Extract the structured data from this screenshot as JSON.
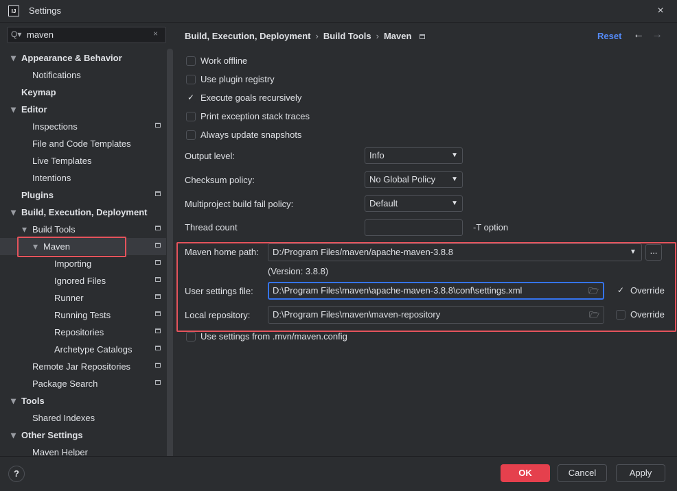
{
  "window": {
    "title": "Settings",
    "logo_text": "IJ",
    "close_icon": "×"
  },
  "search": {
    "value": "maven",
    "icon": "Q▾",
    "clear_icon": "×"
  },
  "sidebar": {
    "items": [
      {
        "label": "Appearance & Behavior",
        "level": 0,
        "expanded": true,
        "bold": true
      },
      {
        "label": "Notifications",
        "level": 1
      },
      {
        "label": "Keymap",
        "level": 0,
        "bold": true
      },
      {
        "label": "Editor",
        "level": 0,
        "expanded": true,
        "bold": true
      },
      {
        "label": "Inspections",
        "level": 1,
        "badge": true
      },
      {
        "label": "File and Code Templates",
        "level": 1
      },
      {
        "label": "Live Templates",
        "level": 1
      },
      {
        "label": "Intentions",
        "level": 1
      },
      {
        "label": "Plugins",
        "level": 0,
        "bold": true,
        "badge": true
      },
      {
        "label": "Build, Execution, Deployment",
        "level": 0,
        "expanded": true,
        "bold": true
      },
      {
        "label": "Build Tools",
        "level": 1,
        "expanded": true,
        "badge": true
      },
      {
        "label": "Maven",
        "level": 2,
        "expanded": true,
        "badge": true,
        "selected": true
      },
      {
        "label": "Importing",
        "level": 3,
        "badge": true
      },
      {
        "label": "Ignored Files",
        "level": 3,
        "badge": true
      },
      {
        "label": "Runner",
        "level": 3,
        "badge": true
      },
      {
        "label": "Running Tests",
        "level": 3,
        "badge": true
      },
      {
        "label": "Repositories",
        "level": 3,
        "badge": true
      },
      {
        "label": "Archetype Catalogs",
        "level": 3,
        "badge": true
      },
      {
        "label": "Remote Jar Repositories",
        "level": 1,
        "badge": true
      },
      {
        "label": "Package Search",
        "level": 1,
        "badge": true
      },
      {
        "label": "Tools",
        "level": 0,
        "expanded": true,
        "bold": true
      },
      {
        "label": "Shared Indexes",
        "level": 1
      },
      {
        "label": "Other Settings",
        "level": 0,
        "expanded": true,
        "bold": true
      },
      {
        "label": "Maven Helper",
        "level": 1
      }
    ]
  },
  "breadcrumb": {
    "items": [
      "Build, Execution, Deployment",
      "Build Tools",
      "Maven"
    ],
    "separator": "›"
  },
  "header": {
    "reset": "Reset",
    "back_icon": "←",
    "forward_icon": "→"
  },
  "checkboxes": [
    {
      "label": "Work offline",
      "checked": false
    },
    {
      "label": "Use plugin registry",
      "checked": false
    },
    {
      "label": "Execute goals recursively",
      "checked": true
    },
    {
      "label": "Print exception stack traces",
      "checked": false
    },
    {
      "label": "Always update snapshots",
      "checked": false
    }
  ],
  "form": {
    "output_level": {
      "label": "Output level:",
      "value": "Info"
    },
    "checksum_policy": {
      "label": "Checksum policy:",
      "value": "No Global Policy"
    },
    "fail_policy": {
      "label": "Multiproject build fail policy:",
      "value": "Default"
    },
    "thread_count": {
      "label": "Thread count",
      "value": "",
      "suffix": "-T option"
    }
  },
  "maven": {
    "home_path": {
      "label": "Maven home path:",
      "value": "D:/Program Files/maven/apache-maven-3.8.8",
      "browse": "..."
    },
    "version": "(Version: 3.8.8)",
    "user_settings": {
      "label": "User settings file:",
      "value": "D:\\Program Files\\maven\\apache-maven-3.8.8\\conf\\settings.xml",
      "override_label": "Override",
      "override": true
    },
    "local_repo": {
      "label": "Local repository:",
      "value": "D:\\Program Files\\maven\\maven-repository",
      "override_label": "Override",
      "override": false
    },
    "mvn_config": {
      "label": "Use settings from .mvn/maven.config",
      "checked": false
    }
  },
  "footer": {
    "help": "?",
    "ok": "OK",
    "cancel": "Cancel",
    "apply": "Apply"
  },
  "colors": {
    "accent": "#548af7",
    "ok_button": "#e5404d",
    "highlight_border": "#e5535c",
    "focus_border": "#3574f0"
  }
}
